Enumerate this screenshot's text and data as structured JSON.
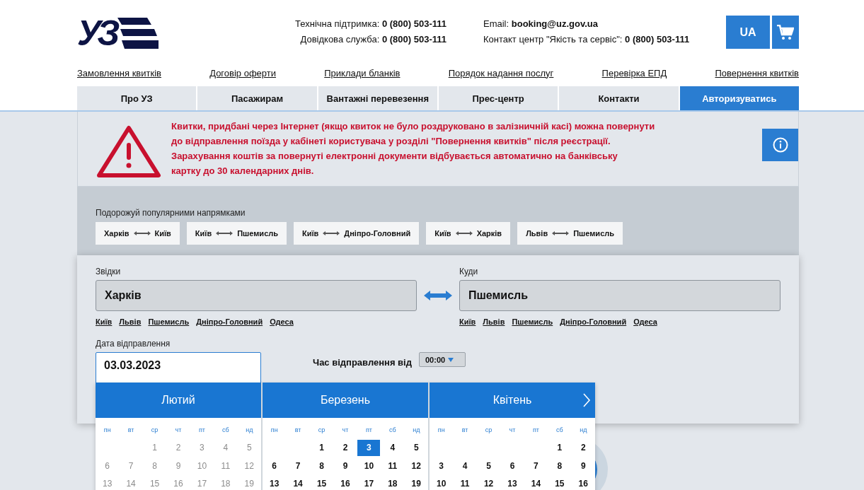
{
  "logo": {
    "text": "УЗ"
  },
  "contacts": [
    {
      "label": "Технічна підтримка:",
      "value": "0 (800) 503-111"
    },
    {
      "label": "Довідкова служба:",
      "value": "0 (800) 503-111"
    }
  ],
  "contacts_right": [
    {
      "label": "Email:",
      "value": "booking@uz.gov.ua"
    },
    {
      "label": "Контакт центр \"Якість та сервіс\":",
      "value": "0 (800) 503-111"
    }
  ],
  "language_button": "UA",
  "top_links": [
    "Замовлення квитків",
    "Договір оферти",
    "Приклади бланків",
    "Порядок надання послуг",
    "Перевірка ЕПД",
    "Повернення квитків"
  ],
  "nav_tabs": [
    {
      "label": "Про УЗ",
      "selected": false
    },
    {
      "label": "Пасажирам",
      "selected": false
    },
    {
      "label": "Вантажні перевезення",
      "selected": false
    },
    {
      "label": "Прес-центр",
      "selected": false
    },
    {
      "label": "Контакти",
      "selected": false
    },
    {
      "label": "Авторизуватись",
      "selected": true
    }
  ],
  "alert": {
    "lines": [
      "Квитки, придбані через Інтернет (якщо квиток не було роздруковано в залізничній касі) можна повернути",
      "до відправлення поїзда у кабінеті користувача у розділі \"Повернення квитків\" після реєстрації.",
      "Зарахування коштів за повернуті електронні документи відбувається автоматично на банківську",
      "картку до 30 календарних днів."
    ]
  },
  "popular": {
    "title": "Подорожуй популярними напрямками",
    "routes": [
      {
        "from": "Харків",
        "to": "Київ"
      },
      {
        "from": "Київ",
        "to": "Пшемисль"
      },
      {
        "from": "Київ",
        "to": "Дніпро-Головний"
      },
      {
        "from": "Київ",
        "to": "Харків"
      },
      {
        "from": "Львів",
        "to": "Пшемисль"
      }
    ]
  },
  "from": {
    "label": "Звідки",
    "value": "Харків",
    "suggestions": [
      "Київ",
      "Львів",
      "Пшемисль",
      "Дніпро-Головний",
      "Одеса"
    ]
  },
  "to": {
    "label": "Куди",
    "value": "Пшемисль",
    "suggestions": [
      "Київ",
      "Львів",
      "Пшемисль",
      "Дніпро-Головний",
      "Одеса"
    ]
  },
  "date": {
    "label": "Дата відправлення",
    "value": "03.03.2023"
  },
  "time": {
    "label": "Час відправлення від",
    "value": "00:00"
  },
  "calendar": {
    "months": [
      {
        "name": "Лютий",
        "disabled": true,
        "weekdays": [
          "пн",
          "вт",
          "ср",
          "чт",
          "пт",
          "сб",
          "нд"
        ],
        "days": [
          {
            "kind": "empty"
          },
          {
            "kind": "empty"
          },
          {
            "kind": "day",
            "label": "1",
            "selected": false
          },
          {
            "kind": "day",
            "label": "2",
            "selected": false
          },
          {
            "kind": "day",
            "label": "3",
            "selected": false
          },
          {
            "kind": "day",
            "label": "4",
            "selected": false
          },
          {
            "kind": "day",
            "label": "5",
            "selected": false
          },
          {
            "kind": "day",
            "label": "6",
            "selected": false
          },
          {
            "kind": "day",
            "label": "7",
            "selected": false
          },
          {
            "kind": "day",
            "label": "8",
            "selected": false
          },
          {
            "kind": "day",
            "label": "9",
            "selected": false
          },
          {
            "kind": "day",
            "label": "10",
            "selected": false
          },
          {
            "kind": "day",
            "label": "11",
            "selected": false
          },
          {
            "kind": "day",
            "label": "12",
            "selected": false
          },
          {
            "kind": "day",
            "label": "13",
            "selected": false
          },
          {
            "kind": "day",
            "label": "14",
            "selected": false
          },
          {
            "kind": "day",
            "label": "15",
            "selected": false
          },
          {
            "kind": "day",
            "label": "16",
            "selected": false
          },
          {
            "kind": "day",
            "label": "17",
            "selected": false
          },
          {
            "kind": "day",
            "label": "18",
            "selected": false
          },
          {
            "kind": "day",
            "label": "19",
            "selected": false
          }
        ]
      },
      {
        "name": "Березень",
        "disabled": false,
        "weekdays": [
          "пн",
          "вт",
          "ср",
          "чт",
          "пт",
          "сб",
          "нд"
        ],
        "days": [
          {
            "kind": "empty"
          },
          {
            "kind": "empty"
          },
          {
            "kind": "day",
            "label": "1",
            "selected": false
          },
          {
            "kind": "day",
            "label": "2",
            "selected": false
          },
          {
            "kind": "day",
            "label": "3",
            "selected": true
          },
          {
            "kind": "day",
            "label": "4",
            "selected": false
          },
          {
            "kind": "day",
            "label": "5",
            "selected": false
          },
          {
            "kind": "day",
            "label": "6",
            "selected": false
          },
          {
            "kind": "day",
            "label": "7",
            "selected": false
          },
          {
            "kind": "day",
            "label": "8",
            "selected": false
          },
          {
            "kind": "day",
            "label": "9",
            "selected": false
          },
          {
            "kind": "day",
            "label": "10",
            "selected": false
          },
          {
            "kind": "day",
            "label": "11",
            "selected": false
          },
          {
            "kind": "day",
            "label": "12",
            "selected": false
          },
          {
            "kind": "day",
            "label": "13",
            "selected": false
          },
          {
            "kind": "day",
            "label": "14",
            "selected": false
          },
          {
            "kind": "day",
            "label": "15",
            "selected": false
          },
          {
            "kind": "day",
            "label": "16",
            "selected": false
          },
          {
            "kind": "day",
            "label": "17",
            "selected": false
          },
          {
            "kind": "day",
            "label": "18",
            "selected": false
          },
          {
            "kind": "day",
            "label": "19",
            "selected": false
          }
        ]
      },
      {
        "name": "Квітень",
        "disabled": false,
        "weekdays": [
          "пн",
          "вт",
          "ср",
          "чт",
          "пт",
          "сб",
          "нд"
        ],
        "days": [
          {
            "kind": "empty"
          },
          {
            "kind": "empty"
          },
          {
            "kind": "empty"
          },
          {
            "kind": "empty"
          },
          {
            "kind": "empty"
          },
          {
            "kind": "day",
            "label": "1",
            "selected": false
          },
          {
            "kind": "day",
            "label": "2",
            "selected": false
          },
          {
            "kind": "day",
            "label": "3",
            "selected": false
          },
          {
            "kind": "day",
            "label": "4",
            "selected": false
          },
          {
            "kind": "day",
            "label": "5",
            "selected": false
          },
          {
            "kind": "day",
            "label": "6",
            "selected": false
          },
          {
            "kind": "day",
            "label": "7",
            "selected": false
          },
          {
            "kind": "day",
            "label": "8",
            "selected": false
          },
          {
            "kind": "day",
            "label": "9",
            "selected": false
          },
          {
            "kind": "day",
            "label": "10",
            "selected": false
          },
          {
            "kind": "day",
            "label": "11",
            "selected": false
          },
          {
            "kind": "day",
            "label": "12",
            "selected": false
          },
          {
            "kind": "day",
            "label": "13",
            "selected": false
          },
          {
            "kind": "day",
            "label": "14",
            "selected": false
          },
          {
            "kind": "day",
            "label": "15",
            "selected": false
          },
          {
            "kind": "day",
            "label": "16",
            "selected": false
          }
        ]
      }
    ]
  }
}
